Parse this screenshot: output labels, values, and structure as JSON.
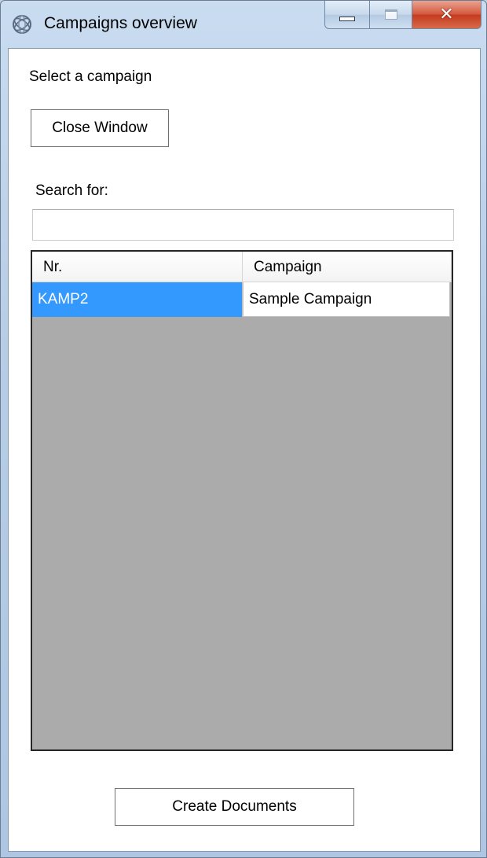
{
  "window": {
    "title": "Campaigns overview",
    "icon": "globe-app-icon",
    "controls": {
      "minimize": "minimize-icon",
      "maximize": "maximize-icon",
      "close": "close-icon"
    }
  },
  "form": {
    "prompt": "Select a campaign",
    "close_button_label": "Close Window",
    "search_label": "Search for:",
    "search_value": "",
    "create_button_label": "Create Documents"
  },
  "grid": {
    "columns": [
      "Nr.",
      "Campaign"
    ],
    "rows": [
      {
        "nr": "KAMP2",
        "campaign": "Sample Campaign",
        "selected": true
      }
    ],
    "colors": {
      "selection": "#3399ff",
      "empty_area": "#ababab"
    }
  }
}
